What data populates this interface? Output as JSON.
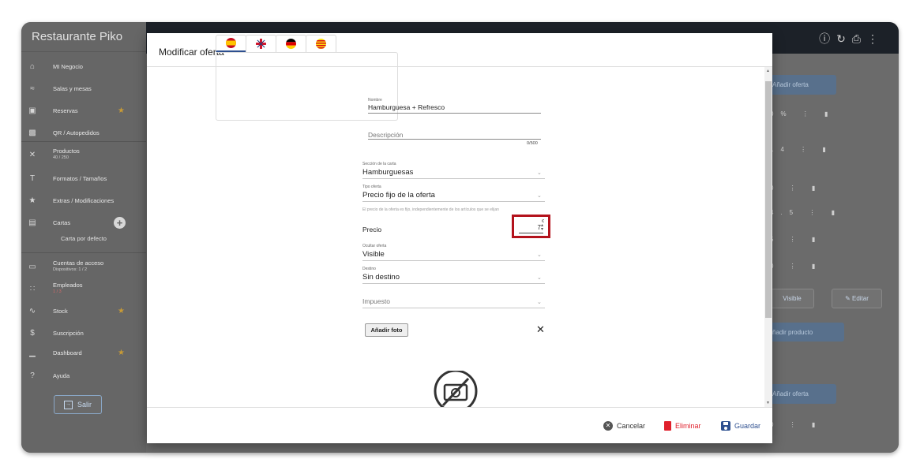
{
  "sidebar": {
    "brand": "Restaurante Piko",
    "items": [
      {
        "label": "MI Negocio",
        "icon": "home-icon"
      },
      {
        "label": "Salas y mesas",
        "icon": "wifi-icon"
      },
      {
        "label": "Reservas",
        "icon": "calendar-icon",
        "starred": true
      },
      {
        "label": "QR / Autopedidos",
        "icon": "qr-icon"
      },
      {
        "label": "Productos",
        "sub": "40 / 250",
        "icon": "utensils-icon"
      },
      {
        "label": "Formatos / Tamaños",
        "icon": "text-size-icon"
      },
      {
        "label": "Extras / Modificaciones",
        "icon": "star-icon"
      },
      {
        "label": "Cartas",
        "icon": "menu-book-icon"
      },
      {
        "label": "Carta por defecto"
      },
      {
        "label": "Cuentas de acceso",
        "sub": "Dispositivos: 1 / 2",
        "icon": "devices-icon"
      },
      {
        "label": "Empleados",
        "sub": "1 / 3",
        "icon": "people-icon"
      },
      {
        "label": "Stock",
        "icon": "trend-icon",
        "starred": true
      },
      {
        "label": "Suscripción",
        "icon": "dollar-icon"
      },
      {
        "label": "Dashboard",
        "icon": "bar-chart-icon",
        "starred": true
      },
      {
        "label": "Ayuda",
        "icon": "help-icon"
      }
    ],
    "logout": "Salir"
  },
  "background": {
    "add_offer": "Añadir oferta",
    "add_product": "ñadir producto",
    "add_offer_2": "Añadir oferta",
    "visible": "Visible",
    "edit": "Editar",
    "rows": [
      "0%",
      "14",
      "0",
      "4.5",
      "5",
      "0",
      "0"
    ]
  },
  "modal": {
    "title": "Modificar oferta",
    "tabs": [
      {
        "lang": "es",
        "icon": "flag-spain-icon"
      },
      {
        "lang": "en",
        "icon": "flag-uk-icon"
      },
      {
        "lang": "de",
        "icon": "flag-germany-icon"
      },
      {
        "lang": "ca",
        "icon": "flag-catalonia-icon"
      }
    ],
    "name_label": "Nombre",
    "name_value": "Hamburguesa + Refresco",
    "desc_label": "Descripción",
    "desc_counter": "0/500",
    "section_label": "Sección de la carta",
    "section_value": "Hamburguesas",
    "type_label": "Tipo oferta",
    "type_value": "Precio fijo de la oferta",
    "type_hint": "El precio de la oferta es fijo, independientemente de los artículos que se elijan",
    "price_label": "Precio",
    "price_value": "7",
    "price_currency": "€",
    "hide_label": "Ocultar oferta",
    "hide_value": "Visible",
    "dest_label": "Destino",
    "dest_value": "Sin destino",
    "tax_label": "Impuesto",
    "photo_button": "Añadir foto",
    "cancel": "Cancelar",
    "delete": "Eliminar",
    "save": "Guardar"
  },
  "colors": {
    "accent": "#2d4f8f",
    "danger": "#e0202c",
    "highlight": "#b3121c"
  }
}
